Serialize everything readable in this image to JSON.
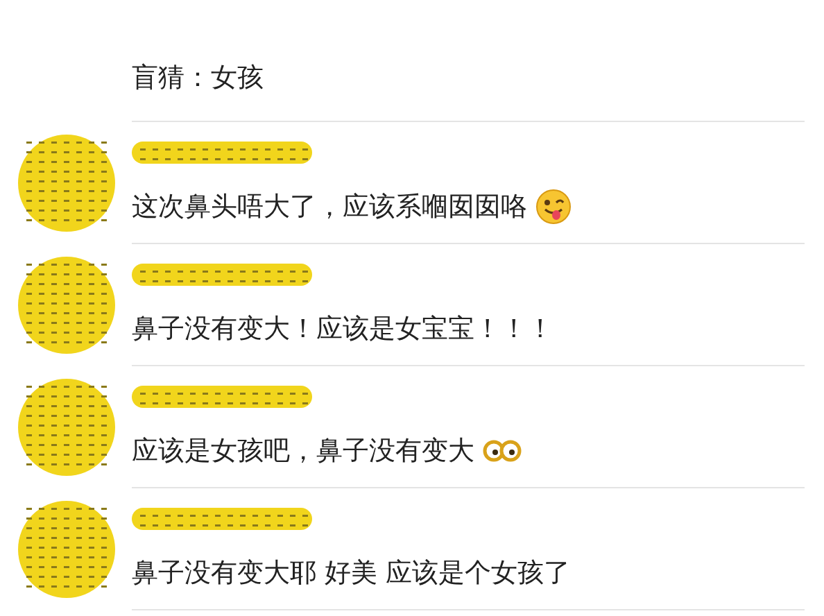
{
  "comments": [
    {
      "kind": "plain",
      "text": "盲猜：女孩",
      "avatar": false
    },
    {
      "kind": "tongue",
      "text": "这次鼻头唔大了，应该系嗰囡囡咯",
      "avatar": true
    },
    {
      "kind": "plain",
      "text": "鼻子没有变大！应该是女宝宝！！！",
      "avatar": true
    },
    {
      "kind": "glasses",
      "text": "应该是女孩吧，鼻子没有变大",
      "avatar": true
    },
    {
      "kind": "plain",
      "text": "鼻子没有变大耶 好美 应该是个女孩了",
      "avatar": true
    }
  ]
}
